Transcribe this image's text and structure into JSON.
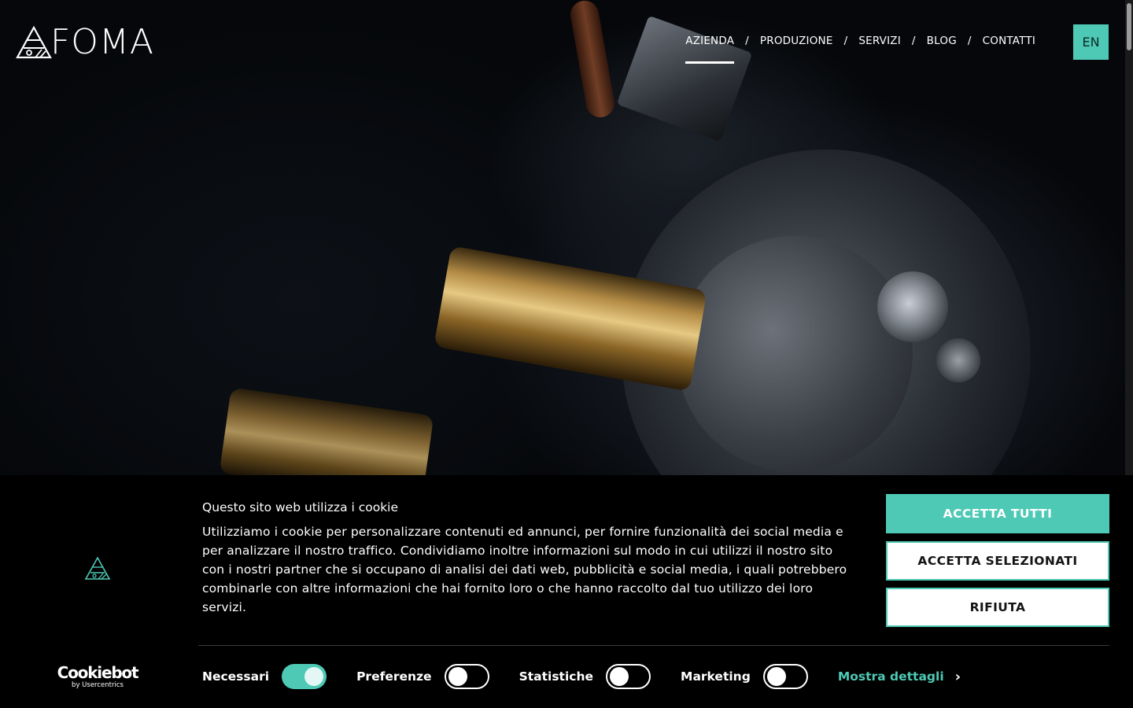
{
  "header": {
    "logo_text": "FOMA",
    "nav": [
      {
        "label": "AZIENDA",
        "active": true
      },
      {
        "label": "PRODUZIONE",
        "active": false
      },
      {
        "label": "SERVIZI",
        "active": false
      },
      {
        "label": "BLOG",
        "active": false
      },
      {
        "label": "CONTATTI",
        "active": false
      }
    ],
    "separator": "/",
    "lang_button": "EN"
  },
  "cookie_banner": {
    "title": "Questo sito web utilizza i cookie",
    "text": "Utilizziamo i cookie per personalizzare contenuti ed annunci, per fornire funzionalità dei social media e per analizzare il nostro traffico. Condividiamo inoltre informazioni sul modo in cui utilizzi il nostro sito con i nostri partner che si occupano di analisi dei dati web, pubblicità e social media, i quali potrebbero combinarle con altre informazioni che hai fornito loro o che hanno raccolto dal tuo utilizzo dei loro servizi.",
    "buttons": {
      "accept_all": "ACCETTA TUTTI",
      "accept_selected": "ACCETTA SELEZIONATI",
      "reject": "RIFIUTA"
    },
    "toggles": [
      {
        "label": "Necessari",
        "checked": true
      },
      {
        "label": "Preferenze",
        "checked": false
      },
      {
        "label": "Statistiche",
        "checked": false
      },
      {
        "label": "Marketing",
        "checked": false
      }
    ],
    "show_details": "Mostra dettagli",
    "cookiebot": {
      "name": "Cookiebot",
      "by": "by Usercentrics"
    }
  },
  "colors": {
    "accent": "#4ec9b5",
    "background": "#000000"
  }
}
